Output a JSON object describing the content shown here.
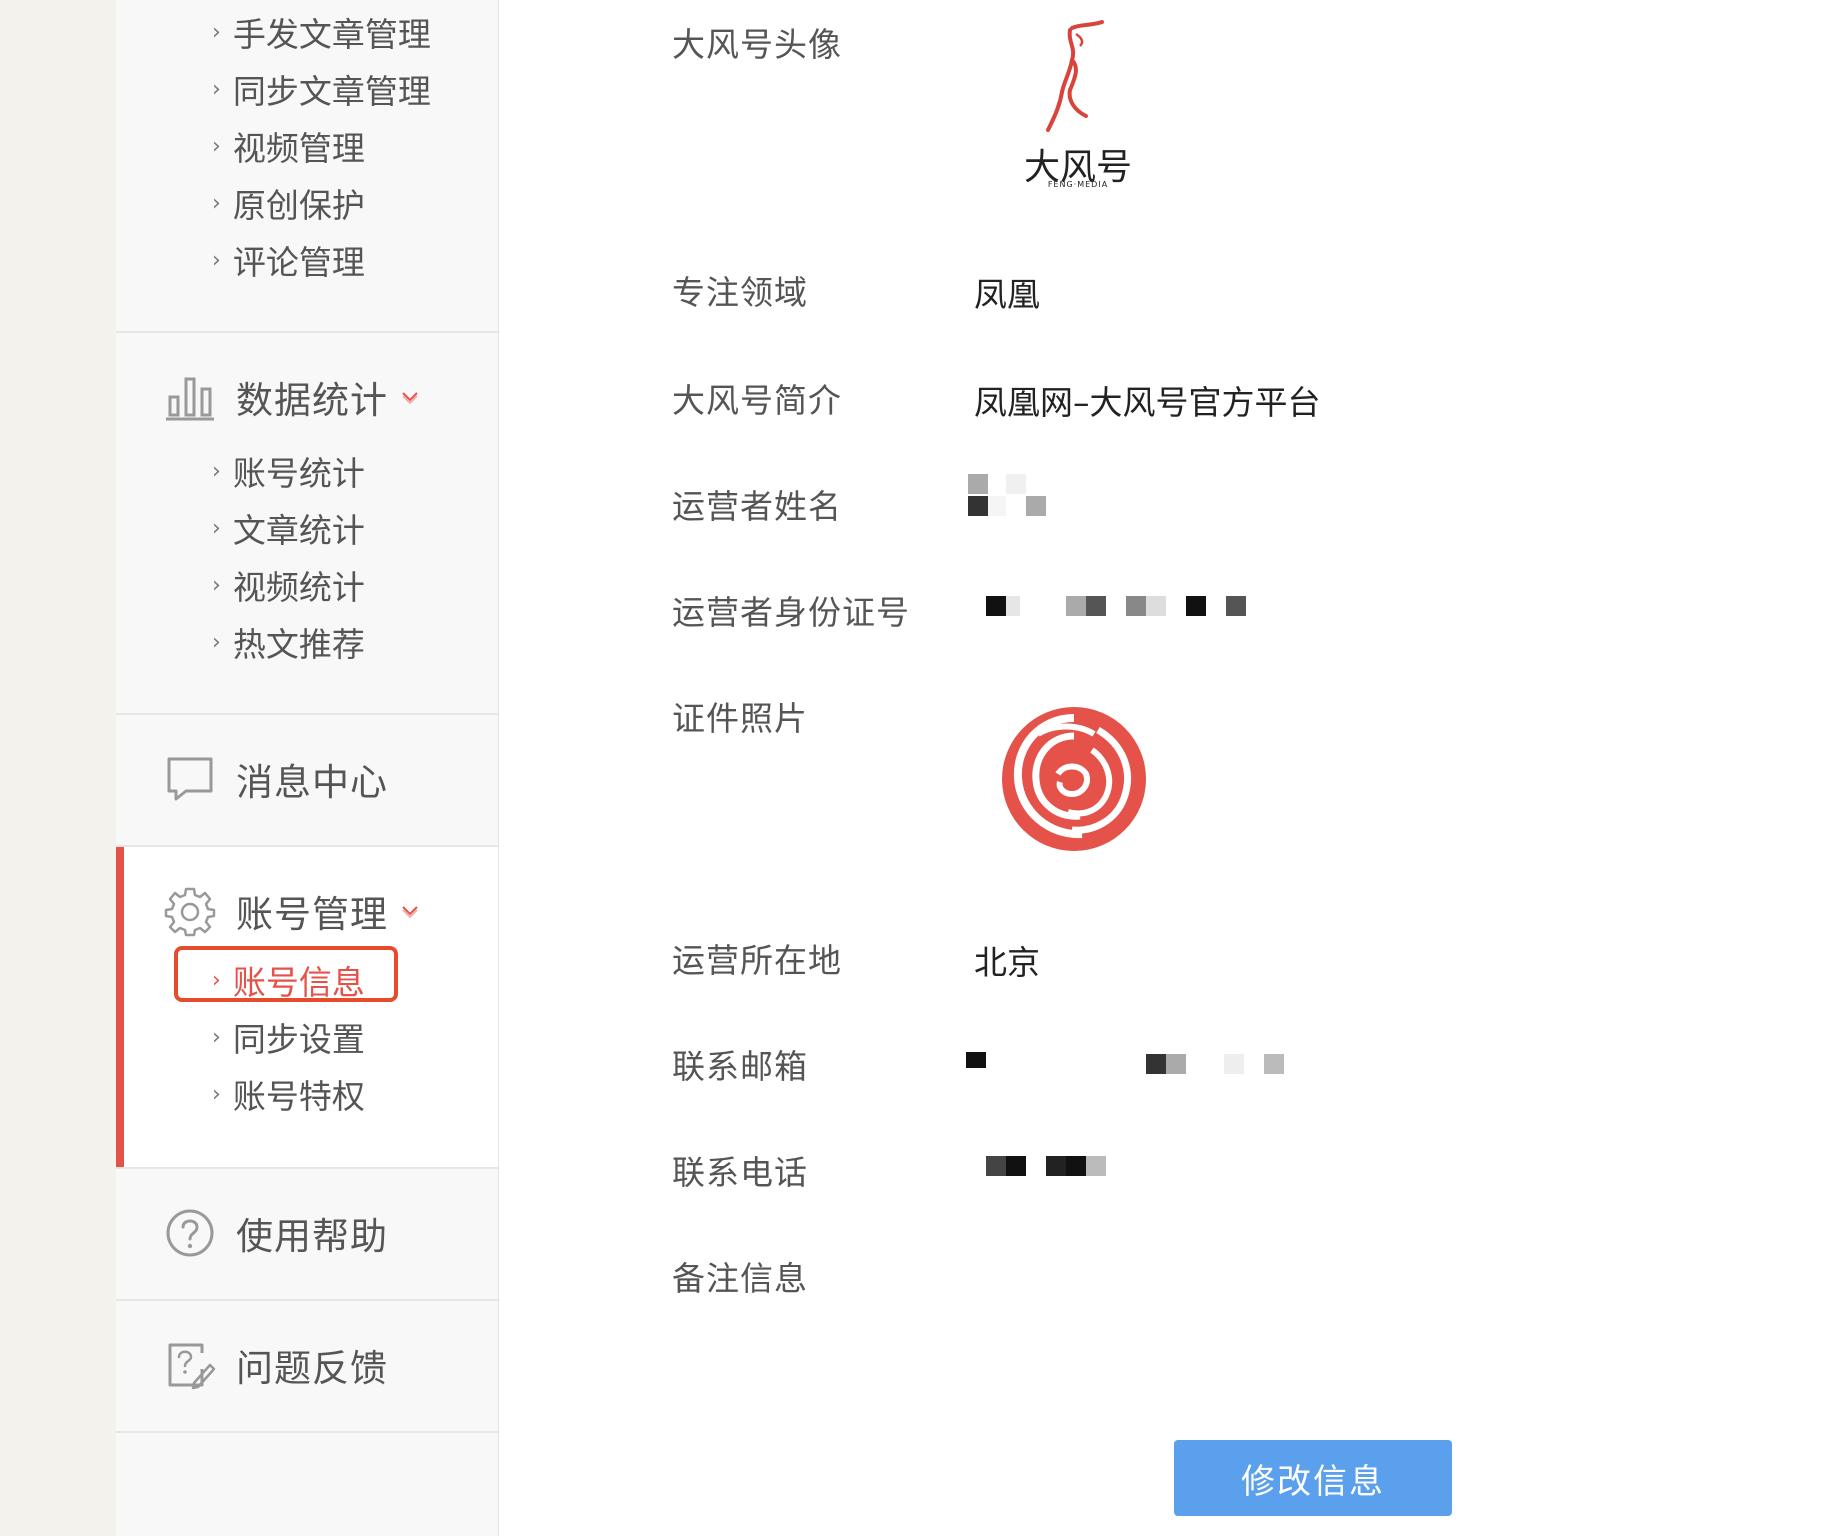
{
  "sidebar": {
    "content_items": [
      {
        "label": "手发文章管理"
      },
      {
        "label": "同步文章管理"
      },
      {
        "label": "视频管理"
      },
      {
        "label": "原创保护"
      },
      {
        "label": "评论管理"
      }
    ],
    "stats": {
      "title": "数据统计",
      "icon": "bar-chart-icon",
      "items": [
        {
          "label": "账号统计"
        },
        {
          "label": "文章统计"
        },
        {
          "label": "视频统计"
        },
        {
          "label": "热文推荐"
        }
      ]
    },
    "messages": {
      "title": "消息中心",
      "icon": "message-icon"
    },
    "account": {
      "title": "账号管理",
      "icon": "gear-icon",
      "items": [
        {
          "label": "账号信息",
          "active": true
        },
        {
          "label": "同步设置"
        },
        {
          "label": "账号特权"
        }
      ]
    },
    "help": {
      "title": "使用帮助",
      "icon": "help-circle-icon"
    },
    "feedback": {
      "title": "问题反馈",
      "icon": "feedback-edit-icon"
    }
  },
  "profile": {
    "avatar_label": "大风号头像",
    "avatar_logo_text": "大风号",
    "avatar_logo_sub": "FENG·MEDIA",
    "domain_label": "专注领域",
    "domain_value": "凤凰",
    "intro_label": "大风号简介",
    "intro_value": "凤凰网–大风号官方平台",
    "operator_name_label": "运营者姓名",
    "operator_id_label": "运营者身份证号",
    "cert_photo_label": "证件照片",
    "location_label": "运营所在地",
    "location_value": "北京",
    "email_label": "联系邮箱",
    "phone_label": "联系电话",
    "remark_label": "备注信息"
  },
  "actions": {
    "edit_label": "修改信息"
  },
  "colors": {
    "accent": "#e5524a",
    "button": "#5aa0ec",
    "highlight": "#e64b2c"
  }
}
